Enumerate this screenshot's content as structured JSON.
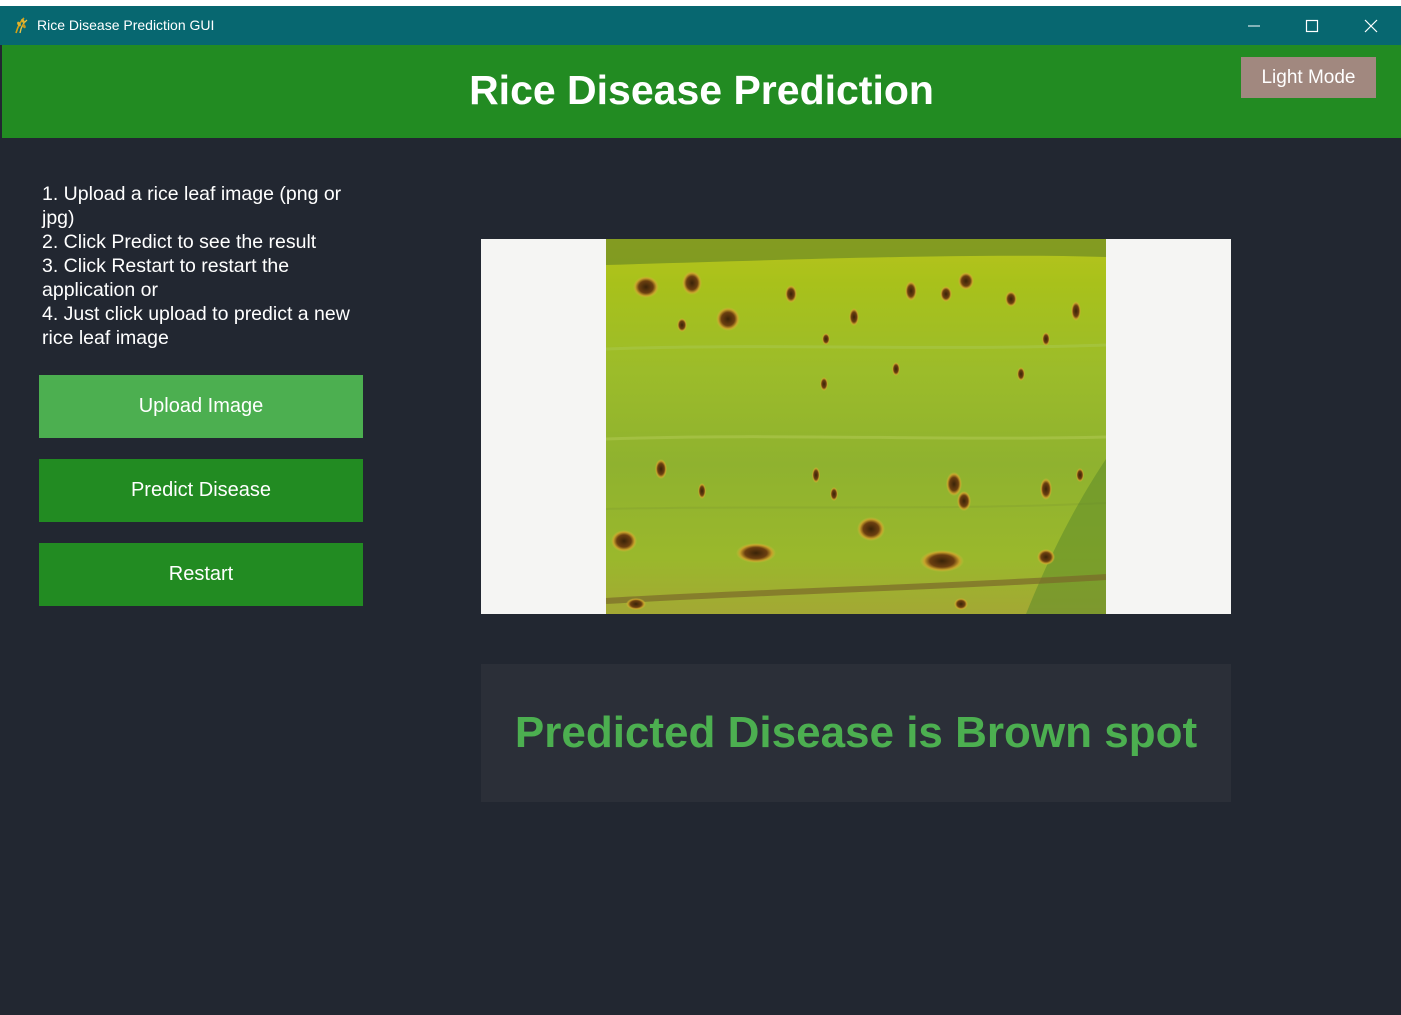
{
  "window": {
    "title": "Rice Disease Prediction GUI",
    "controls": [
      "minimize-icon",
      "maximize-icon",
      "close-icon"
    ]
  },
  "header": {
    "title": "Rice Disease Prediction",
    "theme_toggle_label": "Light Mode"
  },
  "instructions": {
    "steps": [
      "1. Upload a rice leaf image (png or jpg)",
      "2. Click Predict to see the result",
      "3. Click Restart to restart the application or",
      "4. Just click upload to predict a new rice leaf image"
    ]
  },
  "actions": {
    "upload_label": "Upload Image",
    "predict_label": "Predict Disease",
    "restart_label": "Restart"
  },
  "result": {
    "text": "Predicted Disease is Brown spot"
  },
  "colors": {
    "titlebar": "#076770",
    "header": "#228b22",
    "background": "#222731",
    "upload_button": "#4caf50",
    "primary_button": "#228b22",
    "theme_button": "#a1887f",
    "result_text": "#4caf50"
  }
}
